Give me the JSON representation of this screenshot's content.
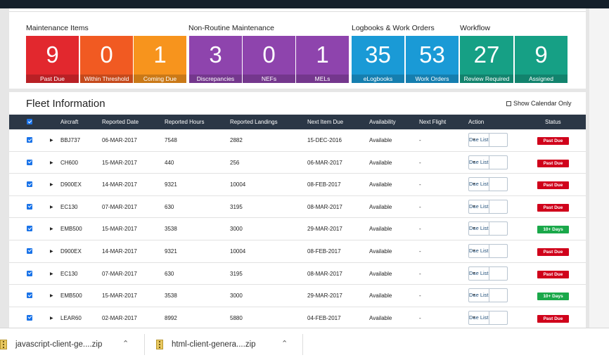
{
  "summary": {
    "groups": [
      "Maintenance Items",
      "Non-Routine Maintenance",
      "Logbooks & Work Orders",
      "Workflow"
    ],
    "tiles": [
      {
        "value": "9",
        "label": "Past Due",
        "color": "#e2282e"
      },
      {
        "value": "0",
        "label": "Within Threshold",
        "color": "#f15a22"
      },
      {
        "value": "1",
        "label": "Coming Due",
        "color": "#f7941d"
      },
      {
        "value": "3",
        "label": "Discrepancies",
        "color": "#8e44ad"
      },
      {
        "value": "0",
        "label": "NEFs",
        "color": "#8e44ad"
      },
      {
        "value": "1",
        "label": "MELs",
        "color": "#8e44ad"
      },
      {
        "value": "35",
        "label": "eLogbooks",
        "color": "#1a9ad6"
      },
      {
        "value": "53",
        "label": "Work Orders",
        "color": "#1a9ad6"
      },
      {
        "value": "27",
        "label": "Review Required",
        "color": "#16a085"
      },
      {
        "value": "9",
        "label": "Assigned",
        "color": "#16a085"
      }
    ]
  },
  "fleet": {
    "title": "Fleet Information",
    "calendar_toggle": "Show Calendar Only",
    "columns": [
      "Aircraft",
      "Reported Date",
      "Reported Hours",
      "Reported Landings",
      "Next Item Due",
      "Availability",
      "Next Flight",
      "Action",
      "Status"
    ],
    "action_label": "Due List",
    "status_colors": {
      "Past Due": "#d0021b",
      "10+ Days": "#1aa84a"
    },
    "rows": [
      {
        "aircraft": "BBJ737",
        "date": "06-MAR-2017",
        "hours": "7548",
        "landings": "2882",
        "next_due": "15-DEC-2016",
        "availability": "Available",
        "next_flight": "-",
        "status": "Past Due"
      },
      {
        "aircraft": "CH600",
        "date": "15-MAR-2017",
        "hours": "440",
        "landings": "256",
        "next_due": "06-MAR-2017",
        "availability": "Available",
        "next_flight": "-",
        "status": "Past Due"
      },
      {
        "aircraft": "D900EX",
        "date": "14-MAR-2017",
        "hours": "9321",
        "landings": "10004",
        "next_due": "08-FEB-2017",
        "availability": "Available",
        "next_flight": "-",
        "status": "Past Due"
      },
      {
        "aircraft": "EC130",
        "date": "07-MAR-2017",
        "hours": "630",
        "landings": "3195",
        "next_due": "08-MAR-2017",
        "availability": "Available",
        "next_flight": "-",
        "status": "Past Due"
      },
      {
        "aircraft": "EMB500",
        "date": "15-MAR-2017",
        "hours": "3538",
        "landings": "3000",
        "next_due": "29-MAR-2017",
        "availability": "Available",
        "next_flight": "-",
        "status": "10+ Days"
      },
      {
        "aircraft": "D900EX",
        "date": "14-MAR-2017",
        "hours": "9321",
        "landings": "10004",
        "next_due": "08-FEB-2017",
        "availability": "Available",
        "next_flight": "-",
        "status": "Past Due"
      },
      {
        "aircraft": "EC130",
        "date": "07-MAR-2017",
        "hours": "630",
        "landings": "3195",
        "next_due": "08-MAR-2017",
        "availability": "Available",
        "next_flight": "-",
        "status": "Past Due"
      },
      {
        "aircraft": "EMB500",
        "date": "15-MAR-2017",
        "hours": "3538",
        "landings": "3000",
        "next_due": "29-MAR-2017",
        "availability": "Available",
        "next_flight": "-",
        "status": "10+ Days"
      },
      {
        "aircraft": "LEAR60",
        "date": "02-MAR-2017",
        "hours": "8992",
        "landings": "5880",
        "next_due": "04-FEB-2017",
        "availability": "Available",
        "next_flight": "-",
        "status": "Past Due"
      }
    ]
  },
  "downloads": [
    {
      "name": "javascript-client-ge....zip"
    },
    {
      "name": "html-client-genera....zip"
    }
  ]
}
